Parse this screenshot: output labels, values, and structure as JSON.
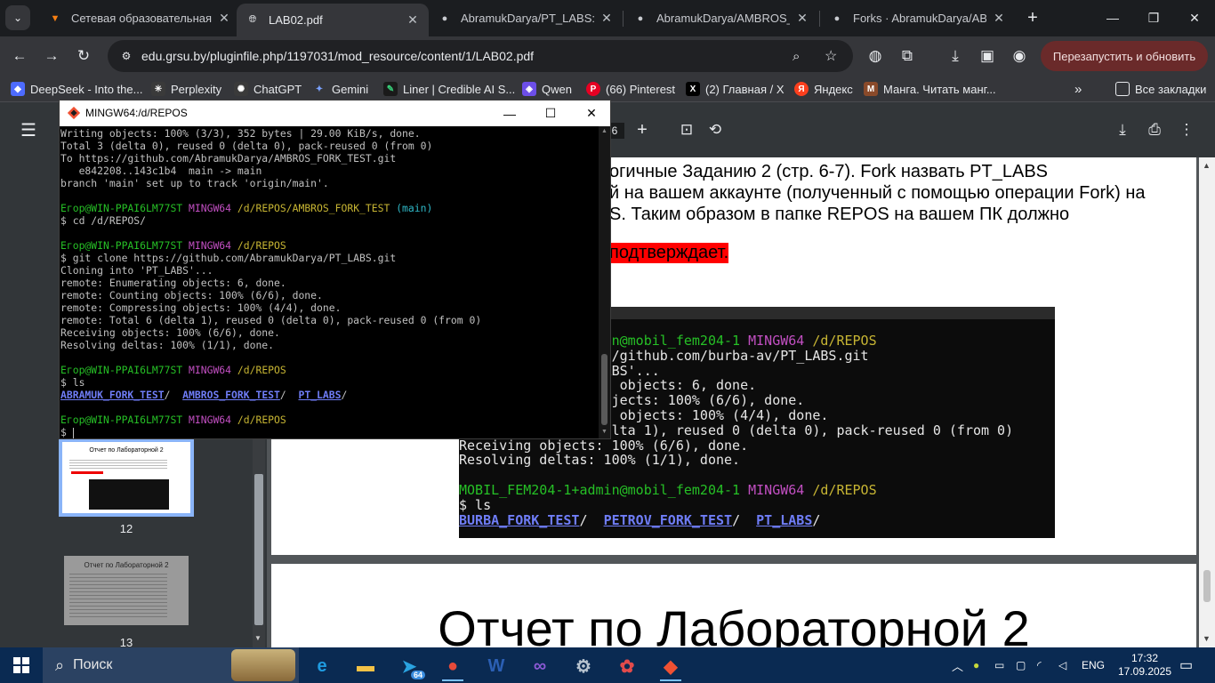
{
  "browser": {
    "tabs": [
      {
        "title": "Сетевая образовательная п",
        "icon": "moodle-icon",
        "active": false
      },
      {
        "title": "LAB02.pdf",
        "icon": "globe-icon",
        "active": true
      },
      {
        "title": "AbramukDarya/PT_LABS: Ла",
        "icon": "github-icon",
        "active": false
      },
      {
        "title": "AbramukDarya/AMBROS_FO",
        "icon": "github-icon",
        "active": false
      },
      {
        "title": "Forks · AbramukDarya/ABRA",
        "icon": "github-icon",
        "active": false
      }
    ],
    "url": "edu.grsu.by/pluginfile.php/1197031/mod_resource/content/1/LAB02.pdf",
    "relaunch_label": "Перезапустить и обновить",
    "bookmarks": [
      {
        "label": "DeepSeek - Into the...",
        "icon": "deepseek-icon",
        "color": "#4d6bfe"
      },
      {
        "label": "Perplexity",
        "icon": "perplexity-icon",
        "color": "#3a3a3a"
      },
      {
        "label": "ChatGPT",
        "icon": "openai-icon",
        "color": "#3a3a3a"
      },
      {
        "label": "Gemini",
        "icon": "gemini-icon",
        "color": "#5b7cf5"
      },
      {
        "label": "Liner | Credible AI S...",
        "icon": "liner-icon",
        "color": "#1a1a1a"
      },
      {
        "label": "Qwen",
        "icon": "qwen-icon",
        "color": "#6c4ee8"
      },
      {
        "label": "(66) Pinterest",
        "icon": "pinterest-icon",
        "color": "#e60023"
      },
      {
        "label": "(2) Главная / X",
        "icon": "x-icon",
        "color": "#000000"
      },
      {
        "label": "Яндекс",
        "icon": "yandex-icon",
        "color": "#fc3f1d"
      },
      {
        "label": "Манга. Читать манг...",
        "icon": "manga-icon",
        "color": "#8a4a2a"
      }
    ],
    "all_bookmarks_label": "Все закладки"
  },
  "pdf": {
    "page_counter": "6",
    "page_text": {
      "line1": "огичные Заданию 2 (стр. 6-7). Fork назвать PT_LABS",
      "line2": "й на вашем аккаунте (полученный с помощью операции Fork) на",
      "line3": "S. Таким образом в папке REPOS на вашем ПК должно",
      "line4": "подтверждает."
    },
    "screenshot_lines": [
      {
        "segments": [
          {
            "text": "MOBIL_FEM204-1+admin@mobil_fem204-1 ",
            "color": "g"
          },
          {
            "text": "MINGW64 ",
            "color": "m"
          },
          {
            "text": "/d/REPOS",
            "color": "y"
          }
        ]
      },
      {
        "segments": [
          {
            "text": "$ git clone https://github.com/burba-av/PT_LABS.git",
            "color": "w"
          }
        ]
      },
      {
        "segments": [
          {
            "text": "Cloning into 'PT_LABS'...",
            "color": "w"
          }
        ]
      },
      {
        "segments": [
          {
            "text": "remote: Enumerating objects: 6, done.",
            "color": "w"
          }
        ]
      },
      {
        "segments": [
          {
            "text": "remote: Counting objects: 100% (6/6), done.",
            "color": "w"
          }
        ]
      },
      {
        "segments": [
          {
            "text": "remote: Compressing objects: 100% (4/4), done.",
            "color": "w"
          }
        ]
      },
      {
        "segments": [
          {
            "text": "remote: Total 6 (delta 1), reused 0 (delta 0), pack-reused 0 (from 0)",
            "color": "w"
          }
        ]
      },
      {
        "segments": [
          {
            "text": "Receiving objects: 100% (6/6), done.",
            "color": "w"
          }
        ]
      },
      {
        "segments": [
          {
            "text": "Resolving deltas: 100% (1/1), done.",
            "color": "w"
          }
        ]
      },
      {
        "segments": [
          {
            "text": "",
            "color": "w"
          }
        ]
      },
      {
        "segments": [
          {
            "text": "MOBIL_FEM204-1+admin@mobil_fem204-1 ",
            "color": "g"
          },
          {
            "text": "MINGW64 ",
            "color": "m"
          },
          {
            "text": "/d/REPOS",
            "color": "y"
          }
        ]
      },
      {
        "segments": [
          {
            "text": "$ ls",
            "color": "w"
          }
        ]
      },
      {
        "segments": [
          {
            "text": "BURBA_FORK_TEST",
            "color": "b"
          },
          {
            "text": "/  ",
            "color": "w"
          },
          {
            "text": "PETROV_FORK_TEST",
            "color": "b"
          },
          {
            "text": "/  ",
            "color": "w"
          },
          {
            "text": "PT_LABS",
            "color": "b"
          },
          {
            "text": "/",
            "color": "w"
          }
        ]
      }
    ],
    "next_page_title": "Отчет по Лабораторной 2",
    "thumbnails": [
      {
        "number": "12",
        "title": "Отчет по Лабораторной 2",
        "selected": true
      },
      {
        "number": "13",
        "title": "Отчет по Лабораторной 2",
        "selected": false
      }
    ]
  },
  "terminal": {
    "title": "MINGW64:/d/REPOS",
    "lines": [
      {
        "segments": [
          {
            "text": "Writing objects: 100% (3/3), 352 bytes | 29.00 KiB/s, done.",
            "color": "w"
          }
        ]
      },
      {
        "segments": [
          {
            "text": "Total 3 (delta 0), reused 0 (delta 0), pack-reused 0 (from 0)",
            "color": "w"
          }
        ]
      },
      {
        "segments": [
          {
            "text": "To https://github.com/AbramukDarya/AMBROS_FORK_TEST.git",
            "color": "w"
          }
        ]
      },
      {
        "segments": [
          {
            "text": "   e842208..143c1b4  main -> main",
            "color": "w"
          }
        ]
      },
      {
        "segments": [
          {
            "text": "branch 'main' set up to track 'origin/main'.",
            "color": "w"
          }
        ]
      },
      {
        "segments": [
          {
            "text": "",
            "color": "w"
          }
        ]
      },
      {
        "segments": [
          {
            "text": "Егор@WIN-PPAI6LM77ST ",
            "color": "g"
          },
          {
            "text": "MINGW64 ",
            "color": "m"
          },
          {
            "text": "/d/REPOS/AMBROS_FORK_TEST ",
            "color": "y"
          },
          {
            "text": "(main)",
            "color": "c"
          }
        ]
      },
      {
        "segments": [
          {
            "text": "$ cd /d/REPOS/",
            "color": "w"
          }
        ]
      },
      {
        "segments": [
          {
            "text": "",
            "color": "w"
          }
        ]
      },
      {
        "segments": [
          {
            "text": "Егор@WIN-PPAI6LM77ST ",
            "color": "g"
          },
          {
            "text": "MINGW64 ",
            "color": "m"
          },
          {
            "text": "/d/REPOS",
            "color": "y"
          }
        ]
      },
      {
        "segments": [
          {
            "text": "$ git clone https://github.com/AbramukDarya/PT_LABS.git",
            "color": "w"
          }
        ]
      },
      {
        "segments": [
          {
            "text": "Cloning into 'PT_LABS'...",
            "color": "w"
          }
        ]
      },
      {
        "segments": [
          {
            "text": "remote: Enumerating objects: 6, done.",
            "color": "w"
          }
        ]
      },
      {
        "segments": [
          {
            "text": "remote: Counting objects: 100% (6/6), done.",
            "color": "w"
          }
        ]
      },
      {
        "segments": [
          {
            "text": "remote: Compressing objects: 100% (4/4), done.",
            "color": "w"
          }
        ]
      },
      {
        "segments": [
          {
            "text": "remote: Total 6 (delta 1), reused 0 (delta 0), pack-reused 0 (from 0)",
            "color": "w"
          }
        ]
      },
      {
        "segments": [
          {
            "text": "Receiving objects: 100% (6/6), done.",
            "color": "w"
          }
        ]
      },
      {
        "segments": [
          {
            "text": "Resolving deltas: 100% (1/1), done.",
            "color": "w"
          }
        ]
      },
      {
        "segments": [
          {
            "text": "",
            "color": "w"
          }
        ]
      },
      {
        "segments": [
          {
            "text": "Егор@WIN-PPAI6LM77ST ",
            "color": "g"
          },
          {
            "text": "MINGW64 ",
            "color": "m"
          },
          {
            "text": "/d/REPOS",
            "color": "y"
          }
        ]
      },
      {
        "segments": [
          {
            "text": "$ ls",
            "color": "w"
          }
        ]
      },
      {
        "segments": [
          {
            "text": "ABRAMUK_FORK_TEST",
            "color": "b"
          },
          {
            "text": "/  ",
            "color": "w"
          },
          {
            "text": "AMBROS_FORK_TEST",
            "color": "b"
          },
          {
            "text": "/  ",
            "color": "w"
          },
          {
            "text": "PT_LABS",
            "color": "b"
          },
          {
            "text": "/",
            "color": "w"
          }
        ]
      },
      {
        "segments": [
          {
            "text": "",
            "color": "w"
          }
        ]
      },
      {
        "segments": [
          {
            "text": "Егор@WIN-PPAI6LM77ST ",
            "color": "g"
          },
          {
            "text": "MINGW64 ",
            "color": "m"
          },
          {
            "text": "/d/REPOS",
            "color": "y"
          }
        ]
      },
      {
        "segments": [
          {
            "text": "$ ",
            "color": "w"
          }
        ]
      }
    ]
  },
  "taskbar": {
    "search_label": "Поиск",
    "apps": [
      {
        "name": "edge-icon",
        "glyph": "e",
        "color": "#1f9be0"
      },
      {
        "name": "explorer-icon",
        "glyph": "▬",
        "color": "#f4c246"
      },
      {
        "name": "telegram-icon",
        "glyph": "➤",
        "color": "#2aa3e0",
        "badge": "64"
      },
      {
        "name": "chrome-icon",
        "glyph": "●",
        "color": "#e64a3a",
        "active": true
      },
      {
        "name": "word-icon",
        "glyph": "W",
        "color": "#2b5fb4"
      },
      {
        "name": "visual-studio-icon",
        "glyph": "∞",
        "color": "#8c5ad6"
      },
      {
        "name": "steam-icon",
        "glyph": "⚙",
        "color": "#b7c3cf"
      },
      {
        "name": "color-app-icon",
        "glyph": "✿",
        "color": "#e34b4b"
      },
      {
        "name": "git-bash-icon",
        "glyph": "◆",
        "color": "#f05133",
        "active": true
      }
    ],
    "language": "ENG",
    "time": "17:32",
    "date": "17.09.2025"
  },
  "colors": {
    "accent_highlight": "#ff0000",
    "terminal_green": "#26c026",
    "terminal_magenta": "#c24fc2",
    "terminal_yellow": "#c7b533",
    "terminal_cyan": "#2fb8c7",
    "terminal_blue": "#6f7df7"
  }
}
